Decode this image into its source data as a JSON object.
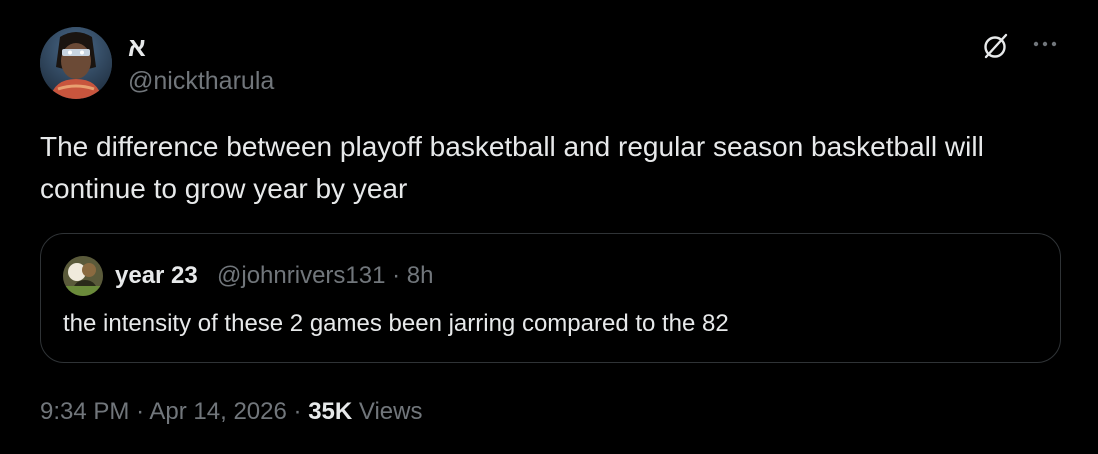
{
  "author": {
    "display_name": "א",
    "handle": "@nicktharula",
    "avatar_icon": "profile-avatar"
  },
  "tweet": {
    "text": "The difference between playoff basketball and regular season basketball will continue to grow year by year"
  },
  "quoted_tweet": {
    "display_name": "year 23",
    "handle": "@johnrivers131",
    "separator": "·",
    "time_ago": "8h",
    "text": "the intensity of these 2 games been jarring compared to the 82"
  },
  "meta": {
    "time": "9:34 PM",
    "separator": "·",
    "date": "Apr 14, 2026",
    "views_count": "35K",
    "views_label": "Views"
  },
  "icons": {
    "grok": "grok-icon",
    "more": "more-horizontal-icon"
  },
  "colors": {
    "background": "#000000",
    "text_primary": "#e7e9ea",
    "text_secondary": "#71767b",
    "border": "#2f3336"
  }
}
